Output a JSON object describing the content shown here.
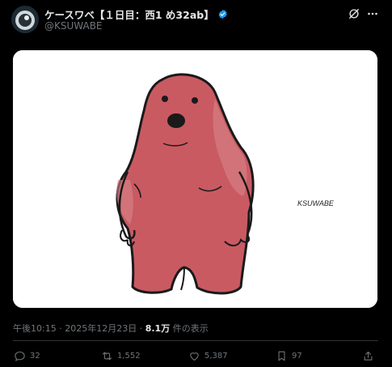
{
  "tweet": {
    "display_name": "ケースワベ【１日目：西1 め32ab】",
    "handle": "@KSUWABE",
    "signature_in_image": "KSUWABE",
    "meta": {
      "time": "午後10:15",
      "separator": " · ",
      "date": "2025年12月23日",
      "separator2": " · ",
      "views_count": "8.1万",
      "views_label": " 件の表示"
    },
    "actions": {
      "replies": "32",
      "reposts": "1,552",
      "likes": "5,387",
      "bookmarks": "97"
    }
  },
  "colors": {
    "background": "#000000",
    "text_primary": "#e7e9ea",
    "text_secondary": "#71767b",
    "verified": "#1d9bf0",
    "bear_fill": "#c95a62"
  },
  "icons": [
    "grok-icon",
    "more-icon",
    "verified-icon",
    "reply-icon",
    "repost-icon",
    "like-icon",
    "bookmark-icon",
    "share-icon"
  ]
}
